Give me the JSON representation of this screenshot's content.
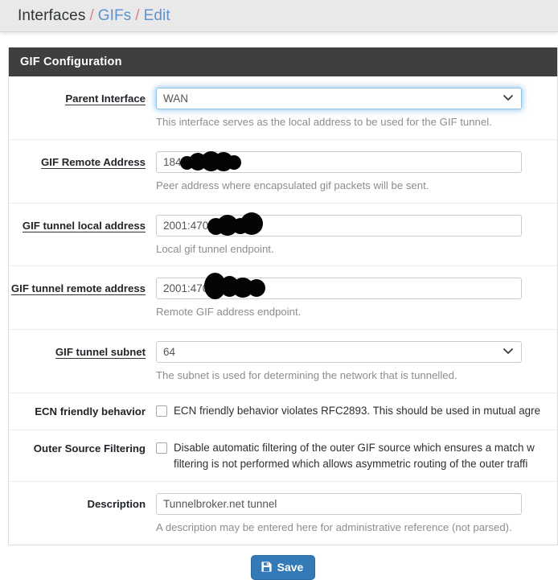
{
  "breadcrumb": {
    "items": [
      {
        "label": "Interfaces",
        "type": "plain"
      },
      {
        "label": "GIFs",
        "type": "link"
      },
      {
        "label": "Edit",
        "type": "link"
      }
    ],
    "separator": "/"
  },
  "panel": {
    "title": "GIF Configuration"
  },
  "fields": {
    "parent_interface": {
      "label": "Parent Interface",
      "value": "WAN",
      "help": "This interface serves as the local address to be used for the GIF tunnel.",
      "options": [
        "WAN"
      ]
    },
    "gif_remote_address": {
      "label": "GIF Remote Address",
      "value": "184.          4",
      "help": "Peer address where encapsulated gif packets will be sent."
    },
    "gif_tunnel_local_address": {
      "label": "GIF tunnel local address",
      "value": "2001:470:        ::2",
      "help": "Local gif tunnel endpoint."
    },
    "gif_tunnel_remote_address": {
      "label": "GIF tunnel remote address",
      "help": "Remote GIF address endpoint.",
      "value": "2001:470        ::1"
    },
    "gif_tunnel_subnet": {
      "label": "GIF tunnel subnet",
      "value": "64",
      "help": "The subnet is used for determining the network that is tunnelled.",
      "options": [
        "64"
      ]
    },
    "ecn_friendly_behavior": {
      "label": "ECN friendly behavior",
      "checkbox_text": "ECN friendly behavior violates RFC2893. This should be used in mutual agre",
      "checked": false
    },
    "outer_source_filtering": {
      "label": "Outer Source Filtering",
      "checkbox_text_line1": "Disable automatic filtering of the outer GIF source which ensures a match w",
      "checkbox_text_line2": "filtering is not performed which allows asymmetric routing of the outer traffi",
      "checked": false
    },
    "description": {
      "label": "Description",
      "value": "Tunnelbroker.net tunnel",
      "help": "A description may be entered here for administrative reference (not parsed)."
    }
  },
  "actions": {
    "save_label": "Save"
  },
  "colors": {
    "panel_header_bg": "#3f3f3f",
    "link": "#5f93d0",
    "separator": "#d9808f",
    "save_button": "#337ab7",
    "breadcrumb_bg": "#e9e9e9"
  }
}
